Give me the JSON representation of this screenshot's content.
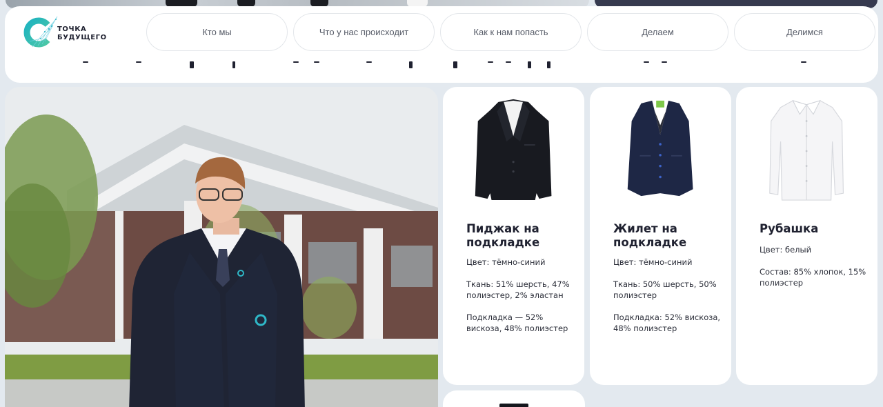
{
  "logo": {
    "line1": "ТОЧКА",
    "line2": "БУДУЩЕГО"
  },
  "nav": [
    {
      "label": "Кто мы"
    },
    {
      "label": "Что у нас происходит"
    },
    {
      "label": "Как к нам попасть"
    },
    {
      "label": "Делаем"
    },
    {
      "label": "Делимся"
    }
  ],
  "products": [
    {
      "title": "Пиджак на подкладке",
      "color": "Цвет: тёмно-синий",
      "details": [
        "Ткань: 51% шерсть, 47% полиэстер, 2% эластан",
        "Подкладка — 52% вискоза, 48% полиэстер"
      ],
      "icon": "blazer-image"
    },
    {
      "title": "Жилет на подкладке",
      "color": "Цвет: тёмно-синий",
      "details": [
        "Ткань: 50% шерсть, 50% полиэстер",
        "Подкладка: 52% вискоза, 48% полиэстер"
      ],
      "icon": "vest-image"
    },
    {
      "title": "Рубашка",
      "color": "Цвет: белый",
      "details": [
        "Состав: 85% хлопок, 15% полиэстер"
      ],
      "icon": "shirt-image"
    }
  ],
  "colors": {
    "background": "#e3e9ef",
    "card": "#ffffff",
    "text": "#1f2130",
    "brand_teal": "#20b5b4",
    "dark_panel": "#363a4f"
  }
}
